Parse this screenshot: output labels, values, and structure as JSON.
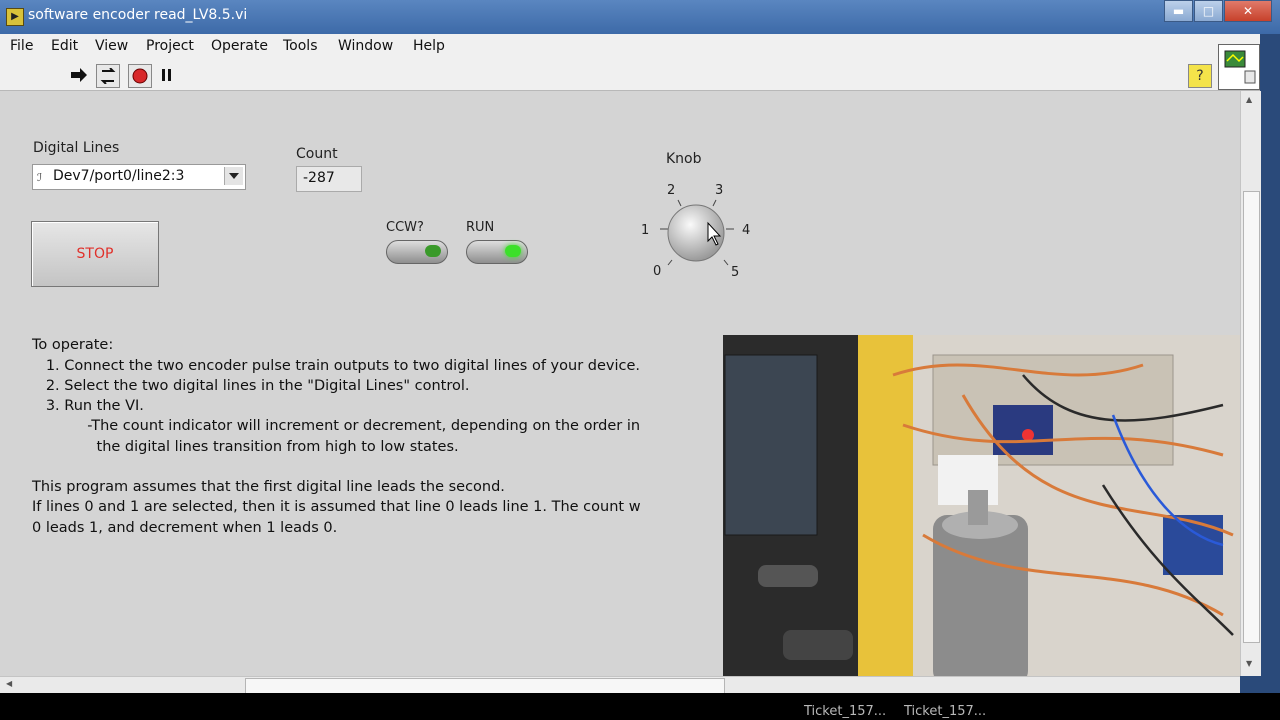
{
  "window": {
    "title": "software encoder read_LV8.5.vi",
    "minimize": "▬",
    "maximize": "□",
    "close": "✕"
  },
  "menu": [
    "File",
    "Edit",
    "View",
    "Project",
    "Operate",
    "Tools",
    "Window",
    "Help"
  ],
  "toolbar": {
    "help": "?"
  },
  "controls": {
    "digital_lines": {
      "label": "Digital Lines",
      "value": "Dev7/port0/line2:3"
    },
    "count": {
      "label": "Count",
      "value": "-287"
    },
    "stop": {
      "label": "STOP"
    },
    "ccw": {
      "label": "CCW?",
      "on": false,
      "color": "#3a9a2a"
    },
    "run": {
      "label": "RUN",
      "on": true,
      "color": "#3ce02a"
    },
    "knob": {
      "label": "Knob",
      "scale": [
        "0",
        "1",
        "2",
        "3",
        "4",
        "5"
      ]
    }
  },
  "instructions": {
    "lines": [
      "To operate:",
      "   1. Connect the two encoder pulse train outputs to two digital lines of your device.",
      "   2. Select the two digital lines in the \"Digital Lines\" control.",
      "   3. Run the VI.",
      "            -The count indicator will increment or decrement, depending on the order in",
      "              the digital lines transition from high to low states.",
      "",
      "This program assumes that the first digital line leads the second.",
      "If lines 0 and 1 are selected, then it is assumed that line 0 leads line 1. The count w",
      "0 leads 1, and decrement when 1 leads 0."
    ]
  },
  "taskbar": [
    "Ticket_157...",
    "Ticket_157..."
  ]
}
